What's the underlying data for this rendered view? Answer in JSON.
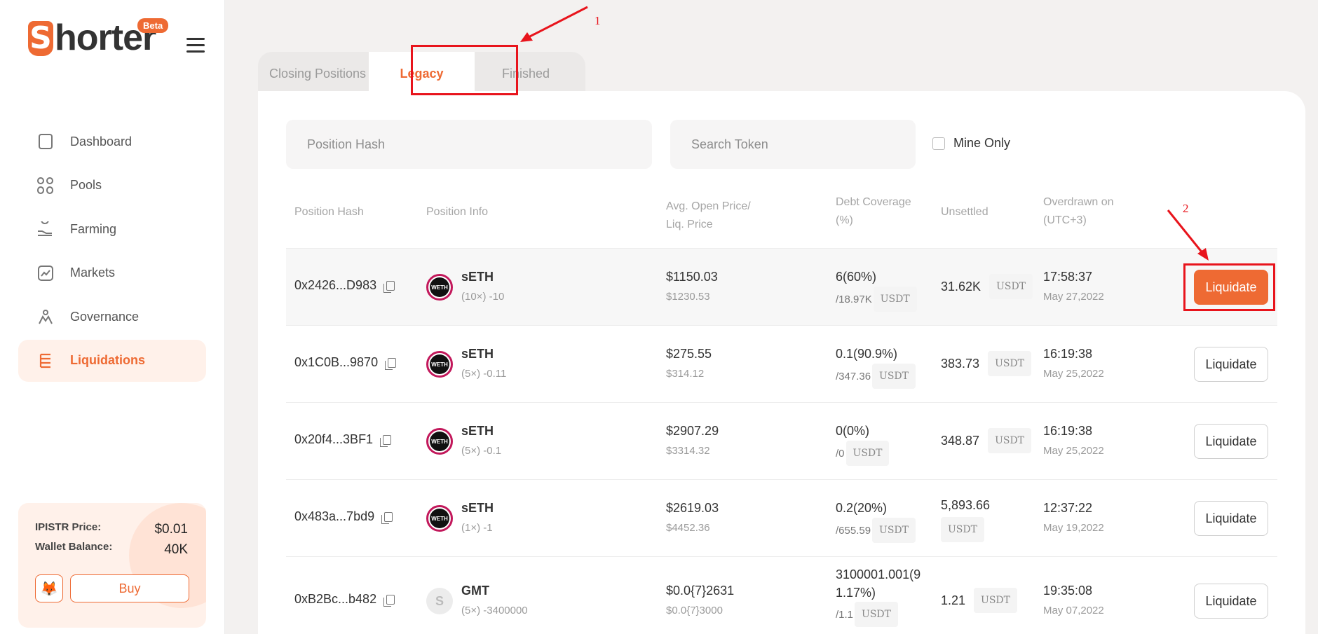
{
  "brand": {
    "logo_letter": "S",
    "logo_rest": "horter",
    "badge": "Beta"
  },
  "nav": [
    {
      "label": "Dashboard",
      "icon": "dashboard-icon"
    },
    {
      "label": "Pools",
      "icon": "pools-icon"
    },
    {
      "label": "Farming",
      "icon": "farming-icon"
    },
    {
      "label": "Markets",
      "icon": "markets-icon"
    },
    {
      "label": "Governance",
      "icon": "governance-icon"
    },
    {
      "label": "Liquidations",
      "icon": "liquidations-icon",
      "active": true
    }
  ],
  "wallet": {
    "price_label": "IPISTR Price:",
    "price_value": "$0.01",
    "balance_label": "Wallet Balance:",
    "balance_value": "40K",
    "buy_label": "Buy"
  },
  "tabs": [
    "Closing Positions",
    "Legacy",
    "Finished"
  ],
  "active_tab": "Legacy",
  "filters": {
    "hash_placeholder": "Position Hash",
    "token_placeholder": "Search Token",
    "mine_only_label": "Mine Only"
  },
  "columns": {
    "hash": "Position Hash",
    "info": "Position Info",
    "price": "Avg. Open Price/ Liq. Price",
    "debt": "Debt Coverage (%)",
    "unsettled": "Unsettled",
    "overdrawn": "Overdrawn on (UTC+3)"
  },
  "rows": [
    {
      "hash": "0x2426...D983",
      "token": "sETH",
      "token_icon": "WETH",
      "leverage": "(10×) -10",
      "open_price": "$1150.03",
      "liq_price": "$1230.53",
      "debt_top": "6(60%)",
      "debt_bottom": "/18.97K",
      "debt_unit": "USDT",
      "unsettled": "31.62K",
      "unsettled_unit": "USDT",
      "time": "17:58:37",
      "date": "May 27,2022",
      "action": "Liquidate"
    },
    {
      "hash": "0x1C0B...9870",
      "token": "sETH",
      "token_icon": "WETH",
      "leverage": "(5×) -0.11",
      "open_price": "$275.55",
      "liq_price": "$314.12",
      "debt_top": "0.1(90.9%)",
      "debt_bottom": "/347.36",
      "debt_unit": "USDT",
      "unsettled": "383.73",
      "unsettled_unit": "USDT",
      "time": "16:19:38",
      "date": "May 25,2022",
      "action": "Liquidate"
    },
    {
      "hash": "0x20f4...3BF1",
      "token": "sETH",
      "token_icon": "WETH",
      "leverage": "(5×) -0.1",
      "open_price": "$2907.29",
      "liq_price": "$3314.32",
      "debt_top": "0(0%)",
      "debt_bottom": "/0",
      "debt_unit": "USDT",
      "unsettled": "348.87",
      "unsettled_unit": "USDT",
      "time": "16:19:38",
      "date": "May 25,2022",
      "action": "Liquidate"
    },
    {
      "hash": "0x483a...7bd9",
      "token": "sETH",
      "token_icon": "WETH",
      "leverage": "(1×) -1",
      "open_price": "$2619.03",
      "liq_price": "$4452.36",
      "debt_top": "0.2(20%)",
      "debt_bottom": "/655.59",
      "debt_unit": "USDT",
      "unsettled": "5,893.66",
      "unsettled_unit": "USDT",
      "time": "12:37:22",
      "date": "May 19,2022",
      "action": "Liquidate"
    },
    {
      "hash": "0xB2Bc...b482",
      "token": "GMT",
      "token_icon": "S",
      "leverage": "(5×) -3400000",
      "open_price": "$0.0{7}2631",
      "liq_price": "$0.0{7}3000",
      "debt_top": "3100001.001(91.17%)",
      "debt_bottom": "/1.1",
      "debt_unit": "USDT",
      "unsettled": "1.21",
      "unsettled_unit": "USDT",
      "time": "19:35:08",
      "date": "May 07,2022",
      "action": "Liquidate"
    }
  ],
  "annotations": {
    "one": "1",
    "two": "2"
  },
  "colors": {
    "accent": "#ee6a33",
    "annotation": "#e8141c"
  }
}
